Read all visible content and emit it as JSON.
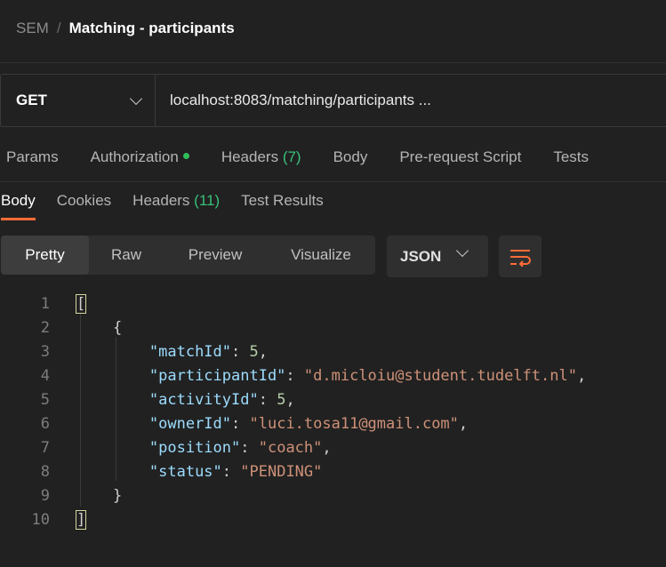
{
  "breadcrumb": {
    "root": "SEM",
    "separator": "/",
    "current": "Matching - participants"
  },
  "request": {
    "method": "GET",
    "url": "localhost:8083/matching/participants ..."
  },
  "request_tabs": [
    {
      "label": "Params"
    },
    {
      "label": "Authorization"
    },
    {
      "label": "Headers",
      "count": "(7)"
    },
    {
      "label": "Body"
    },
    {
      "label": "Pre-request Script"
    },
    {
      "label": "Tests"
    }
  ],
  "response_tabs": [
    {
      "label": "Body",
      "active": true
    },
    {
      "label": "Cookies"
    },
    {
      "label": "Headers",
      "count": "(11)"
    },
    {
      "label": "Test Results"
    }
  ],
  "view_modes": {
    "pretty": "Pretty",
    "raw": "Raw",
    "preview": "Preview",
    "visualize": "Visualize",
    "active": "Pretty"
  },
  "format": "JSON",
  "colors": {
    "accent": "#ff6c37",
    "status_dot": "#2fbf5a",
    "count": "#39c07a",
    "key": "#9cdcfe",
    "string": "#ce9178",
    "number": "#b5cea8"
  },
  "response_body": {
    "line_numbers": [
      "1",
      "2",
      "3",
      "4",
      "5",
      "6",
      "7",
      "8",
      "9",
      "10"
    ],
    "open_array": "[",
    "open_object": "{",
    "close_object": "}",
    "close_array": "]",
    "fields": [
      {
        "key": "\"matchId\"",
        "value": "5",
        "type": "number",
        "comma": ","
      },
      {
        "key": "\"participantId\"",
        "value": "\"d.micloiu@student.tudelft.nl\"",
        "type": "string",
        "comma": ","
      },
      {
        "key": "\"activityId\"",
        "value": "5",
        "type": "number",
        "comma": ","
      },
      {
        "key": "\"ownerId\"",
        "value": "\"luci.tosa11@gmail.com\"",
        "type": "string",
        "comma": ","
      },
      {
        "key": "\"position\"",
        "value": "\"coach\"",
        "type": "string",
        "comma": ","
      },
      {
        "key": "\"status\"",
        "value": "\"PENDING\"",
        "type": "string",
        "comma": ""
      }
    ]
  }
}
